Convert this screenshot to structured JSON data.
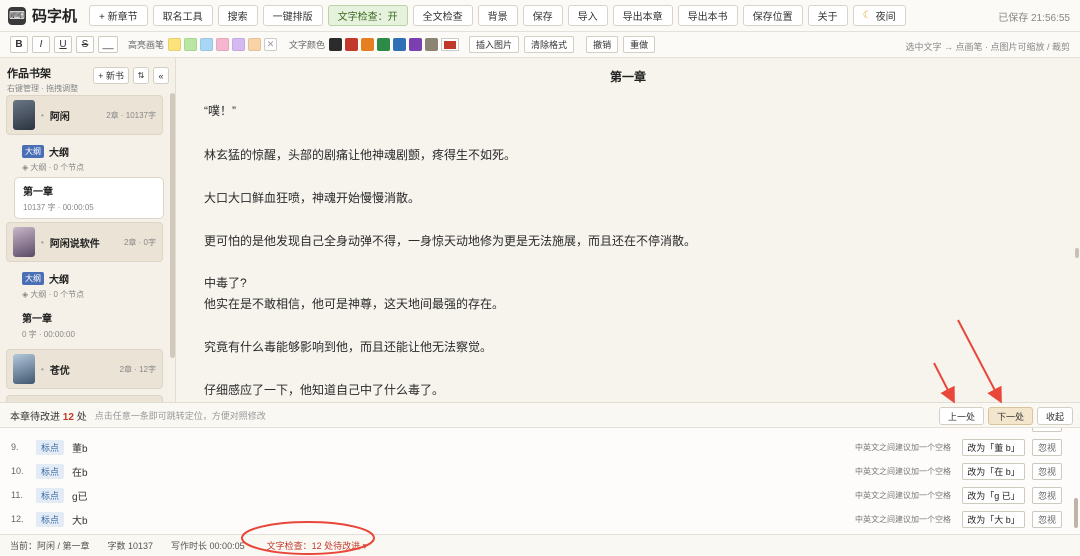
{
  "app": {
    "title": "码字机",
    "logo_icon": "typewriter-icon",
    "autosave": "已保存 21:56:55"
  },
  "toolbar": {
    "buttons": [
      "+ 新章节",
      "取名工具",
      "搜索",
      "一键排版",
      "文字检查：开",
      "全文检查",
      "背景",
      "保存",
      "导入",
      "导出本章",
      "导出本书",
      "保存位置",
      "关于",
      "夜间"
    ],
    "night_icon": "moon-icon"
  },
  "format": {
    "bold": "B",
    "italic": "I",
    "underline": "U",
    "strike": "S",
    "blank": "__",
    "highlight_label": "高亮画笔",
    "highlight_colors": [
      "#fbe27a",
      "#b9e6a0",
      "#a9d6f5",
      "#f7b6cf",
      "#d6b9f2",
      "#f8d3a6"
    ],
    "highlight_clear": "✕",
    "text_color_label": "文字颜色",
    "text_colors": [
      "#2b2b2b",
      "#c0392b",
      "#e67e22",
      "#2e8b47",
      "#2f6fb3",
      "#7a3fb0",
      "#8c8472"
    ],
    "text_color_current": "#c0392b",
    "insert_image": "插入图片",
    "clear_format": "清除格式",
    "undo": "撤销",
    "redo": "重做",
    "hint": "选中文字 → 点画笔 · 点图片可缩放 / 裁剪"
  },
  "sidebar": {
    "title": "作品书架",
    "subtitle": "右键管理 · 拖拽调整",
    "new_book": "+ 新书",
    "sort": "⇅",
    "collapse": "«",
    "books": [
      {
        "name": "阿闲",
        "dot": "•",
        "meta": "2章 · 10137字",
        "cover_color": "#3b4451",
        "outline": {
          "tag": "大纲",
          "name": "大纲",
          "meta": "◈ 大纲 · 0 个节点"
        },
        "chapters": [
          {
            "name": "第一章",
            "meta": "10137 字 · 00:00:05",
            "active": true
          }
        ]
      },
      {
        "name": "阿闲说软件",
        "dot": "•",
        "meta": "2章 · 0字",
        "cover_color": "#7a6f8a",
        "outline": {
          "tag": "大纲",
          "name": "大纲",
          "meta": "◈ 大纲 · 0 个节点"
        },
        "chapters": [
          {
            "name": "第一章",
            "meta": "0 字 · 00:00:00",
            "active": false
          }
        ]
      },
      {
        "name": "苍优",
        "dot": "•",
        "meta": "2章 · 12字",
        "cover_color": "#5c7390"
      }
    ]
  },
  "editor": {
    "chapter_title": "第一章",
    "paragraphs": [
      "“噗！”",
      "林玄猛的惊醒，头部的剧痛让他神魂剧颤，疼得生不如死。",
      "大口大口鲜血狂喷，神魂开始慢慢消散。",
      "更可怕的是他发现自己全身动弹不得，一身惊天动地修为更是无法施展，而且还在不停消散。",
      "中毒了?",
      "他实在是不敢相信，他可是神尊，这天地间最强的存在。",
      "究竟有什么毒能够影响到他，而且还能让他无法察觉。",
      "仔细感应了一下，他知道自己中了什么毒了。"
    ]
  },
  "check_panel": {
    "title_prefix": "本章待改进",
    "count": "12",
    "title_suffix": "处",
    "hint": "点击任意一条即可跳转定位，方便对照修改",
    "prev": "上一处",
    "next": "下一处",
    "collapse": "收起",
    "issues": [
      {
        "num": "9.",
        "tag": "标点",
        "text": "董b",
        "desc": "中英文之间建议加一个空格",
        "fix": "改为「董 b」",
        "ignore": "忽视"
      },
      {
        "num": "10.",
        "tag": "标点",
        "text": "在b",
        "desc": "中英文之间建议加一个空格",
        "fix": "改为「在 b」",
        "ignore": "忽视"
      },
      {
        "num": "11.",
        "tag": "标点",
        "text": "g已",
        "desc": "中英文之间建议加一个空格",
        "fix": "改为「g 已」",
        "ignore": "忽视"
      },
      {
        "num": "12.",
        "tag": "标点",
        "text": "大b",
        "desc": "中英文之间建议加一个空格",
        "fix": "改为「大 b」",
        "ignore": "忽视"
      }
    ]
  },
  "status": {
    "current": "当前：阿闲 / 第一章",
    "words": "字数 10137",
    "time": "写作时长 00:00:05",
    "check": "文字检查：12 处待改进 ▾"
  },
  "annotation_color": "#e8473a"
}
